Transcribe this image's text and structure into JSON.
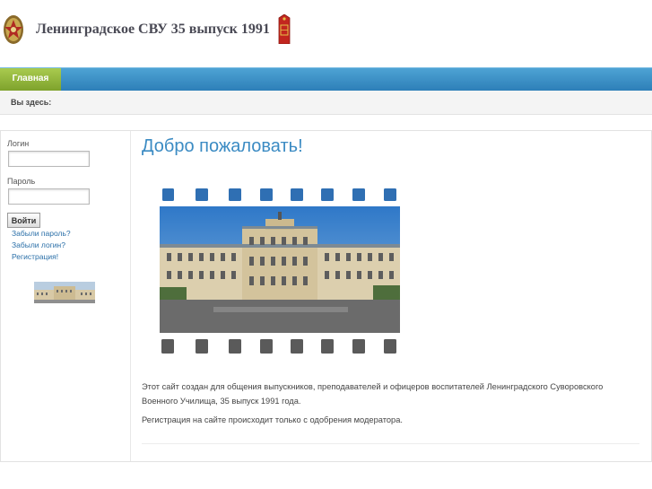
{
  "header": {
    "site_title": "Ленинградское СВУ 35 выпуск 1991"
  },
  "nav": {
    "home_label": "Главная"
  },
  "breadcrumb": {
    "label": "Вы здесь:"
  },
  "login": {
    "username_label": "Логин",
    "password_label": "Пароль",
    "submit_label": "Войти",
    "forgot_password": "Забыли пароль?",
    "forgot_login": "Забыли логин?",
    "register": "Регистрация!"
  },
  "content": {
    "title": "Добро пожаловать!",
    "paragraph1": "Этот сайт создан для общения выпускников, преподавателей и офицеров воспитателей Ленинградского Суворовского Военного Училища, 35 выпуск 1991 года.",
    "paragraph2": "Регистрация на сайте происходит только с одобрения модератора."
  },
  "colors": {
    "nav_blue": "#3b92c8",
    "home_green": "#93b83c",
    "title_blue": "#3b8bc3",
    "link_blue": "#2a6fa8",
    "film_top_squares": "#2f6fb3",
    "film_bottom_squares": "#5b5b5b"
  },
  "icons": {
    "left_emblem": "svu-badge-icon",
    "right_emblem": "shoulder-strap-icon"
  }
}
